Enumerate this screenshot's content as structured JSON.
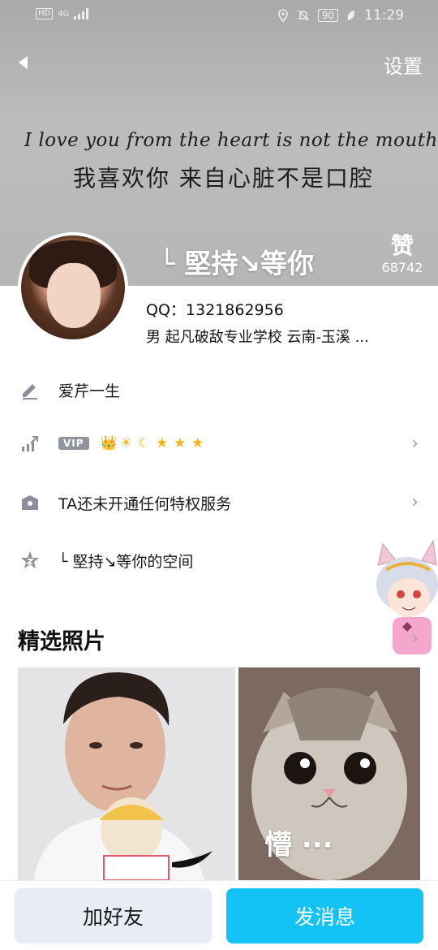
{
  "status_bar": {
    "left_badge": "HD",
    "network": "4G",
    "battery": "90",
    "time": "11:29"
  },
  "header": {
    "settings_label": "设置",
    "cover_quote_en": "I love you from the heart is not the mouth",
    "cover_quote_cn": "我喜欢你 来自心脏不是口腔",
    "nickname": "└ 堅持↘等你",
    "like_icon": "赞",
    "like_count": "68742"
  },
  "profile": {
    "qq_line": "QQ：1321862956",
    "info_line": "男  起凡破敌专业学校  云南-玉溪 ..."
  },
  "rows": [
    {
      "icon": "pen-icon",
      "label": "爱芹一生"
    },
    {
      "icon": "vip-level-icon",
      "badge": "VIP",
      "level_icons": [
        "👑",
        "☀",
        "☾",
        "★",
        "★",
        "★"
      ]
    },
    {
      "icon": "crown-icon",
      "label": "TA还未开通任何特权服务"
    },
    {
      "icon": "qzone-icon",
      "label": "└ 堅持↘等你的空间"
    }
  ],
  "photos_section": {
    "title": "精选照片",
    "photo2_caption": "懵 ···"
  },
  "bottom_bar": {
    "add_friend_label": "加好友",
    "send_message_label": "发消息"
  },
  "colors": {
    "primary": "#14c3f5",
    "secondary_button": "#e9ecf4"
  }
}
